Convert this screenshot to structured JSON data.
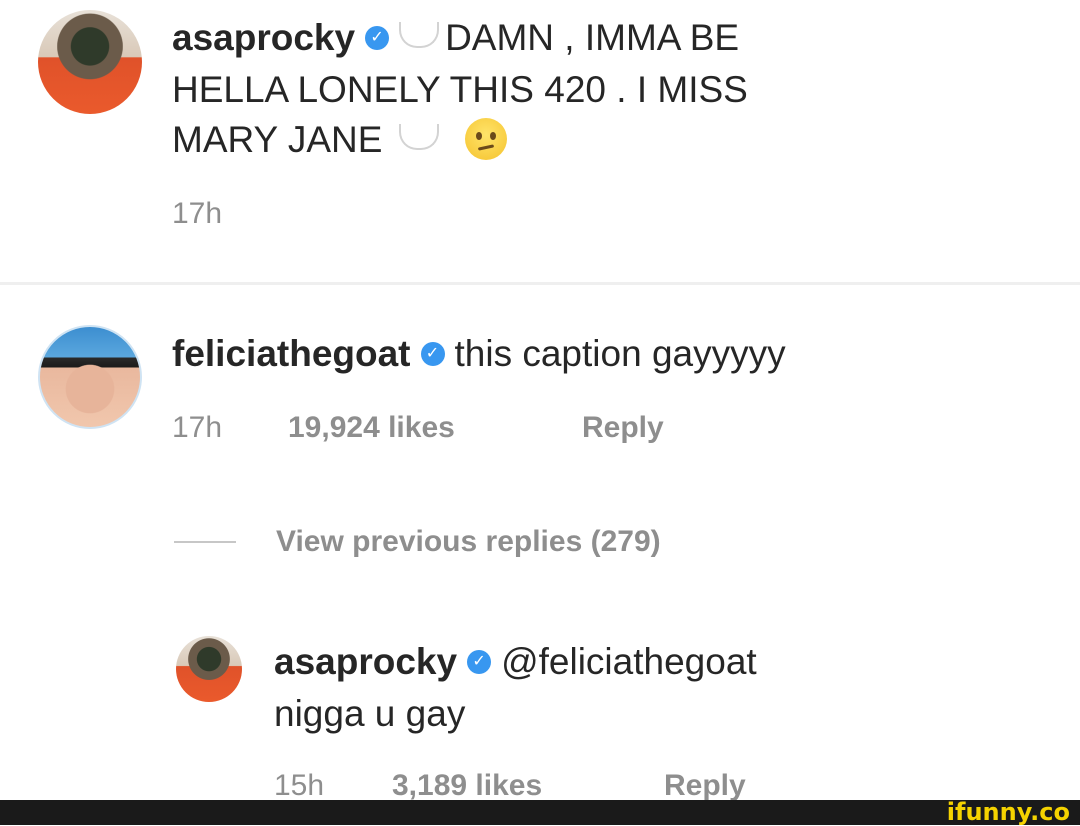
{
  "post_caption": {
    "username": "asaprocky",
    "line1": "DAMN , IMMA BE",
    "line2": "HELLA LONELY THIS 420 . I MISS",
    "line3": "MARY JANE",
    "time": "17h"
  },
  "comment": {
    "username": "feliciathegoat",
    "text": "this caption gayyyyy",
    "time": "17h",
    "likes": "19,924 likes",
    "reply_label": "Reply"
  },
  "view_previous": {
    "label": "View previous replies (279)"
  },
  "reply": {
    "username": "asaprocky",
    "mention": "@feliciathegoat",
    "text": "nigga u gay",
    "time": "15h",
    "likes": "3,189 likes",
    "reply_label": "Reply"
  },
  "watermark": {
    "text": "ifunny.co"
  },
  "icons": {
    "verified": "verified-badge-icon",
    "cloud": "speech-cloud-icon",
    "emoji": "confused-face-icon"
  },
  "colors": {
    "verified_blue": "#3897f0",
    "meta_gray": "#8e8e8e",
    "text_dark": "#262626",
    "watermark_yellow": "#f5d300"
  }
}
